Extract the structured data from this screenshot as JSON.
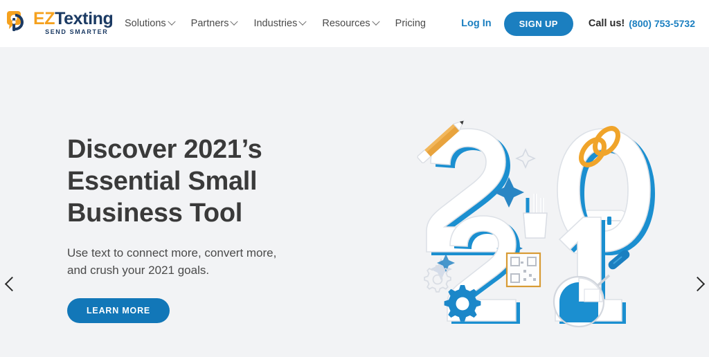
{
  "header": {
    "logo": {
      "icon": "speech-bubble-logo-icon",
      "text_ez": "EZ",
      "text_texting": "Texting",
      "tagline": "SEND SMARTER",
      "color_orange": "#f5a11e",
      "color_navy": "#1b3a63"
    },
    "nav": [
      {
        "label": "Solutions",
        "has_dropdown": true
      },
      {
        "label": "Partners",
        "has_dropdown": true
      },
      {
        "label": "Industries",
        "has_dropdown": true
      },
      {
        "label": "Resources",
        "has_dropdown": true
      },
      {
        "label": "Pricing",
        "has_dropdown": false
      }
    ],
    "login_label": "Log In",
    "signup_label": "SIGN UP",
    "call_label": "Call us!",
    "phone": "(800) 753-5732",
    "accent_blue": "#1b7fc0"
  },
  "hero": {
    "headline_line1": "Discover 2021’s",
    "headline_line2": "Essential Small",
    "headline_line3": "Business Tool",
    "subhead_line1": "Use text to connect more, convert more,",
    "subhead_line2": "and crush your 2021 goals.",
    "cta_label": "LEARN MORE",
    "background": "#f2f3f5",
    "cta_color": "#1277b8",
    "illustration": {
      "name": "2021-illustration",
      "digits_top": "20",
      "digits_bottom": "21",
      "elements": [
        "pencil-icon",
        "chain-link-icon",
        "slider-panel-icon",
        "pencil-cup-icon",
        "star-icon",
        "gear-icon",
        "qr-code-icon",
        "magnifier-pie-chart-icon"
      ],
      "color_blue": "#1b8fd0",
      "color_orange": "#e8a33d"
    },
    "prev_arrow": "chevron-left-icon",
    "next_arrow": "chevron-right-icon"
  }
}
